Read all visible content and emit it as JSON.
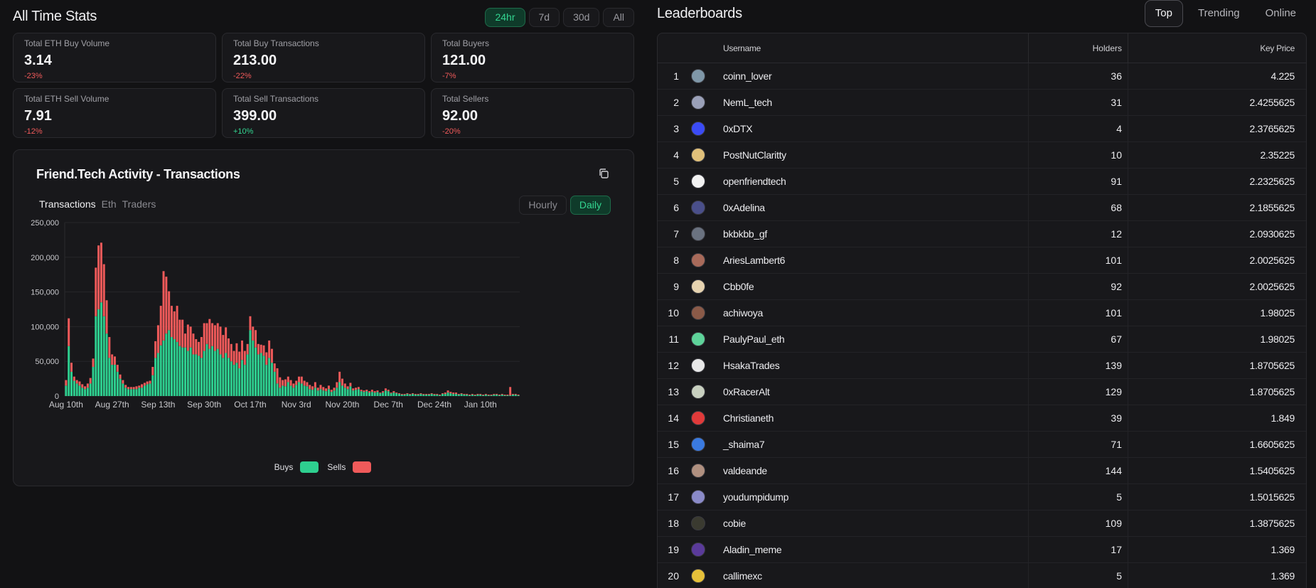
{
  "stats": {
    "title": "All Time Stats",
    "ranges": [
      "24hr",
      "7d",
      "30d",
      "All"
    ],
    "active_range": "24hr",
    "cards": [
      {
        "label": "Total ETH Buy Volume",
        "value": "3.14",
        "delta": "-23%",
        "trend": "neg"
      },
      {
        "label": "Total Buy Transactions",
        "value": "213.00",
        "delta": "-22%",
        "trend": "neg"
      },
      {
        "label": "Total Buyers",
        "value": "121.00",
        "delta": "-7%",
        "trend": "neg"
      },
      {
        "label": "Total ETH Sell Volume",
        "value": "7.91",
        "delta": "-12%",
        "trend": "neg"
      },
      {
        "label": "Total Sell Transactions",
        "value": "399.00",
        "delta": "+10%",
        "trend": "pos"
      },
      {
        "label": "Total Sellers",
        "value": "92.00",
        "delta": "-20%",
        "trend": "neg"
      }
    ]
  },
  "activity": {
    "title": "Friend.Tech Activity - Transactions",
    "tabs": [
      "Transactions",
      "Eth",
      "Traders"
    ],
    "active_tab": "Transactions",
    "intervals": [
      "Hourly",
      "Daily"
    ],
    "active_interval": "Daily",
    "copy_icon": "copy-icon"
  },
  "chart_data": {
    "type": "bar",
    "stacked": true,
    "title": "Friend.Tech Activity - Transactions",
    "xlabel": "",
    "ylabel": "",
    "ylim": [
      0,
      250000
    ],
    "yticks": [
      0,
      50000,
      100000,
      150000,
      200000,
      250000
    ],
    "ytick_labels": [
      "0",
      "50,000",
      "100,000",
      "150,000",
      "200,000",
      "250,000"
    ],
    "xtick_labels": [
      "Aug 10th",
      "Aug 27th",
      "Sep 13th",
      "Sep 30th",
      "Oct 17th",
      "Nov 3rd",
      "Nov 20th",
      "Dec 7th",
      "Dec 24th",
      "Jan 10th"
    ],
    "xtick_index": [
      0,
      17,
      34,
      51,
      68,
      85,
      102,
      119,
      136,
      153
    ],
    "grid": true,
    "legend": "bottom-center",
    "colors": {
      "buys": "#2ecf8f",
      "sells": "#f05a5a"
    },
    "series": [
      {
        "name": "Buys",
        "values": [
          15000,
          72000,
          35000,
          22000,
          18000,
          15000,
          12000,
          10000,
          12000,
          18000,
          42000,
          115000,
          125000,
          135000,
          115000,
          90000,
          55000,
          45000,
          45000,
          35000,
          25000,
          18000,
          12000,
          10000,
          10000,
          10000,
          10000,
          12000,
          12000,
          15000,
          17000,
          18000,
          30000,
          55000,
          62000,
          73000,
          80000,
          90000,
          95000,
          85000,
          82000,
          78000,
          72000,
          70000,
          70000,
          65000,
          70000,
          60000,
          60000,
          58000,
          55000,
          65000,
          75000,
          68000,
          72000,
          65000,
          68000,
          60000,
          55000,
          62000,
          55000,
          50000,
          45000,
          48000,
          40000,
          52000,
          45000,
          60000,
          95000,
          80000,
          70000,
          60000,
          62000,
          58000,
          45000,
          55000,
          48000,
          35000,
          18000,
          12000,
          15000,
          14000,
          20000,
          15000,
          12000,
          16000,
          20000,
          18000,
          15000,
          14000,
          10000,
          9000,
          12000,
          8000,
          10000,
          8000,
          7000,
          10000,
          6000,
          8000,
          12000,
          20000,
          15000,
          12000,
          10000,
          14000,
          8000,
          9000,
          10000,
          7000,
          6000,
          7000,
          5000,
          6000,
          5000,
          6000,
          4000,
          5000,
          8000,
          7000,
          4000,
          5000,
          4000,
          3000,
          2000,
          2000,
          3000,
          2000,
          3000,
          2000,
          2000,
          3000,
          2000,
          2000,
          2000,
          3000,
          2000,
          2000,
          1000,
          3000,
          3000,
          5000,
          4000,
          3000,
          3000,
          2000,
          3000,
          2000,
          2000,
          1000,
          2000,
          1000,
          2000,
          2000,
          1000,
          2000,
          1000,
          1000,
          2000,
          2000,
          1000,
          2000,
          1000,
          1000,
          1000,
          2000,
          2000,
          1000
        ]
      },
      {
        "name": "Sells",
        "values": [
          8000,
          40000,
          13000,
          6000,
          5000,
          6000,
          5000,
          4000,
          6000,
          8000,
          12000,
          70000,
          92000,
          86000,
          75000,
          48000,
          30000,
          15000,
          12000,
          10000,
          6000,
          5000,
          4000,
          3000,
          3000,
          3000,
          4000,
          3000,
          5000,
          4000,
          4000,
          4000,
          12000,
          24000,
          40000,
          57000,
          100000,
          82000,
          56000,
          45000,
          40000,
          52000,
          38000,
          40000,
          20000,
          38000,
          30000,
          30000,
          22000,
          20000,
          30000,
          40000,
          30000,
          43000,
          33000,
          37000,
          37000,
          40000,
          33000,
          37000,
          28000,
          25000,
          20000,
          28000,
          24000,
          28000,
          20000,
          15000,
          20000,
          20000,
          25000,
          15000,
          12000,
          15000,
          18000,
          25000,
          20000,
          12000,
          22000,
          15000,
          8000,
          10000,
          8000,
          8000,
          6000,
          6000,
          8000,
          10000,
          7000,
          6000,
          6000,
          5000,
          8000,
          4000,
          6000,
          5000,
          4000,
          5000,
          3000,
          4000,
          8000,
          15000,
          10000,
          6000,
          4000,
          5000,
          3000,
          3000,
          3000,
          2000,
          2000,
          2000,
          2000,
          3000,
          2000,
          2000,
          1000,
          2000,
          3000,
          2000,
          1000,
          2000,
          1000,
          1000,
          1000,
          1000,
          1000,
          1000,
          1000,
          1000,
          1000,
          1000,
          1000,
          1000,
          1000,
          1000,
          1000,
          1000,
          1000,
          1000,
          2000,
          3000,
          2000,
          2000,
          2000,
          1000,
          1000,
          1000,
          1000,
          1000,
          1000,
          1000,
          1000,
          1000,
          1000,
          1000,
          1000,
          1000,
          1000,
          1000,
          1000,
          1000,
          1000,
          1000,
          12000,
          1000,
          1000,
          1000
        ]
      }
    ]
  },
  "legend": {
    "buys": "Buys",
    "sells": "Sells"
  },
  "leaderboard": {
    "title": "Leaderboards",
    "tabs": [
      "Top",
      "Trending",
      "Online"
    ],
    "active_tab": "Top",
    "columns": {
      "username": "Username",
      "holders": "Holders",
      "price": "Key Price"
    },
    "rows": [
      {
        "rank": "1",
        "user": "coinn_lover",
        "holders": "36",
        "price": "4.225",
        "avatar": "#7f97a8"
      },
      {
        "rank": "2",
        "user": "NemL_tech",
        "holders": "31",
        "price": "2.4255625",
        "avatar": "#9aa0b8"
      },
      {
        "rank": "3",
        "user": "0xDTX",
        "holders": "4",
        "price": "2.3765625",
        "avatar": "#3b4bf5"
      },
      {
        "rank": "4",
        "user": "PostNutClaritty",
        "holders": "10",
        "price": "2.35225",
        "avatar": "#e0c07a"
      },
      {
        "rank": "5",
        "user": "openfriendtech",
        "holders": "91",
        "price": "2.2325625",
        "avatar": "#f2f2f2"
      },
      {
        "rank": "6",
        "user": "0xAdelina",
        "holders": "68",
        "price": "2.1855625",
        "avatar": "#4a4f8a"
      },
      {
        "rank": "7",
        "user": "bkbkbb_gf",
        "holders": "12",
        "price": "2.0930625",
        "avatar": "#6a7280"
      },
      {
        "rank": "8",
        "user": "AriesLambert6",
        "holders": "101",
        "price": "2.0025625",
        "avatar": "#a86a5a"
      },
      {
        "rank": "9",
        "user": "Cbb0fe",
        "holders": "92",
        "price": "2.0025625",
        "avatar": "#e6d3b0"
      },
      {
        "rank": "10",
        "user": "achiwoya",
        "holders": "101",
        "price": "1.98025",
        "avatar": "#8a5a48"
      },
      {
        "rank": "11",
        "user": "PaulyPaul_eth",
        "holders": "67",
        "price": "1.98025",
        "avatar": "#5ed39a"
      },
      {
        "rank": "12",
        "user": "HsakaTrades",
        "holders": "139",
        "price": "1.8705625",
        "avatar": "#e8e8e8"
      },
      {
        "rank": "13",
        "user": "0xRacerAlt",
        "holders": "129",
        "price": "1.8705625",
        "avatar": "#c8d0c0"
      },
      {
        "rank": "14",
        "user": "Christianeth",
        "holders": "39",
        "price": "1.849",
        "avatar": "#e03a3a"
      },
      {
        "rank": "15",
        "user": "_shaima7",
        "holders": "71",
        "price": "1.6605625",
        "avatar": "#3a7ae0"
      },
      {
        "rank": "16",
        "user": "valdeande",
        "holders": "144",
        "price": "1.5405625",
        "avatar": "#b09080"
      },
      {
        "rank": "17",
        "user": "youdumpidump",
        "holders": "5",
        "price": "1.5015625",
        "avatar": "#8a8ac8"
      },
      {
        "rank": "18",
        "user": "cobie",
        "holders": "109",
        "price": "1.3875625",
        "avatar": "#3a3a30"
      },
      {
        "rank": "19",
        "user": "Aladin_meme",
        "holders": "17",
        "price": "1.369",
        "avatar": "#5a3a9a"
      },
      {
        "rank": "20",
        "user": "callimexc",
        "holders": "5",
        "price": "1.369",
        "avatar": "#e6c03a"
      }
    ]
  }
}
